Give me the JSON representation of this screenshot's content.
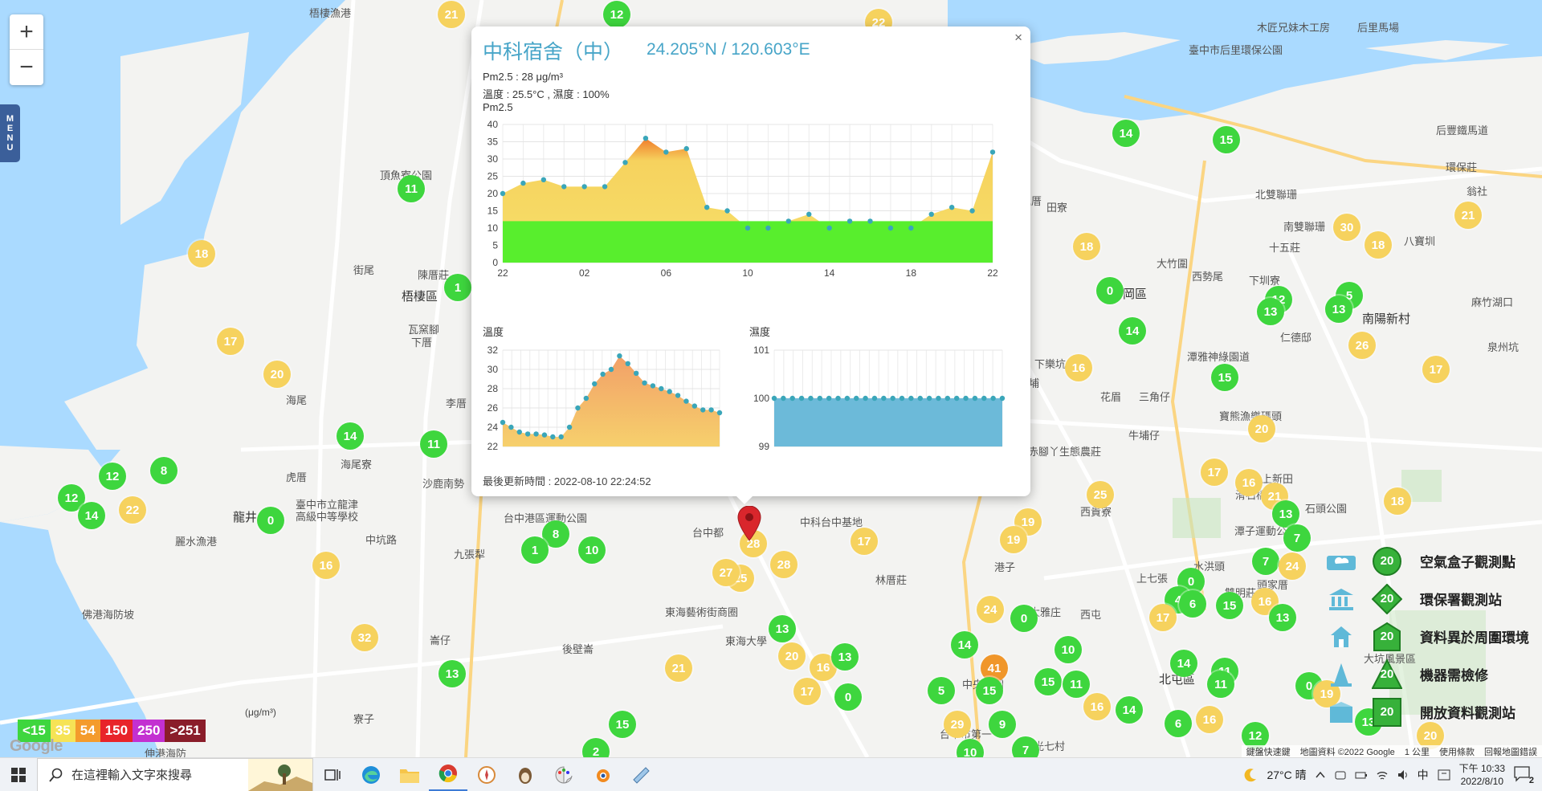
{
  "map": {
    "zoom_in": "+",
    "zoom_out": "−",
    "menu_label": [
      "M",
      "E",
      "N",
      "U"
    ],
    "places": [
      {
        "t": "梧棲漁港",
        "x": 385,
        "y": 6
      },
      {
        "t": "頂魚寮公園",
        "x": 473,
        "y": 208
      },
      {
        "t": "梧棲區",
        "x": 500,
        "y": 358,
        "big": true
      },
      {
        "t": "陳厝莊",
        "x": 520,
        "y": 332
      },
      {
        "t": "街尾",
        "x": 440,
        "y": 326
      },
      {
        "t": "瓦窯腳",
        "x": 508,
        "y": 400
      },
      {
        "t": "下厝",
        "x": 512,
        "y": 416
      },
      {
        "t": "海尾",
        "x": 356,
        "y": 488
      },
      {
        "t": "李厝",
        "x": 555,
        "y": 492
      },
      {
        "t": "海尾寮",
        "x": 424,
        "y": 568
      },
      {
        "t": "虎厝",
        "x": 356,
        "y": 584
      },
      {
        "t": "沙鹿南勢",
        "x": 526,
        "y": 592
      },
      {
        "t": "臺中市立龍津",
        "x": 368,
        "y": 618
      },
      {
        "t": "高級中等學校",
        "x": 368,
        "y": 633
      },
      {
        "t": "龍井",
        "x": 290,
        "y": 633,
        "big": true
      },
      {
        "t": "麗水漁港",
        "x": 218,
        "y": 664
      },
      {
        "t": "中坑路",
        "x": 455,
        "y": 662
      },
      {
        "t": "台中港區運動公園",
        "x": 627,
        "y": 635
      },
      {
        "t": "九張犁",
        "x": 565,
        "y": 680
      },
      {
        "t": "佛港海防坡",
        "x": 102,
        "y": 755
      },
      {
        "t": "崙仔",
        "x": 535,
        "y": 787
      },
      {
        "t": "後壁崙",
        "x": 700,
        "y": 798
      },
      {
        "t": "東海藝術街商圈",
        "x": 828,
        "y": 752
      },
      {
        "t": "東海大學",
        "x": 903,
        "y": 788
      },
      {
        "t": "中科台中基地",
        "x": 996,
        "y": 640
      },
      {
        "t": "林厝莊",
        "x": 1090,
        "y": 712
      },
      {
        "t": "台中都",
        "x": 862,
        "y": 653
      },
      {
        "t": "中塊厝",
        "x": 1258,
        "y": 240
      },
      {
        "t": "田寮",
        "x": 1303,
        "y": 248
      },
      {
        "t": "大竹圍",
        "x": 1440,
        "y": 318
      },
      {
        "t": "神岡區",
        "x": 1383,
        "y": 355,
        "big": true
      },
      {
        "t": "西勢尾",
        "x": 1484,
        "y": 334
      },
      {
        "t": "下圳寮",
        "x": 1555,
        "y": 339
      },
      {
        "t": "北雙聯珊",
        "x": 1563,
        "y": 232
      },
      {
        "t": "南雙聯珊",
        "x": 1598,
        "y": 272
      },
      {
        "t": "十五莊",
        "x": 1580,
        "y": 298
      },
      {
        "t": "南陽新村",
        "x": 1696,
        "y": 386,
        "big": true
      },
      {
        "t": "仁德邸",
        "x": 1594,
        "y": 410
      },
      {
        "t": "潭雅神綠園道",
        "x": 1478,
        "y": 434
      },
      {
        "t": "花眉",
        "x": 1370,
        "y": 484
      },
      {
        "t": "三角仔",
        "x": 1418,
        "y": 484
      },
      {
        "t": "牛埔仔",
        "x": 1405,
        "y": 532
      },
      {
        "t": "赤腳丫生態農莊",
        "x": 1280,
        "y": 552
      },
      {
        "t": "西貴寮",
        "x": 1345,
        "y": 627
      },
      {
        "t": "上七張",
        "x": 1415,
        "y": 710
      },
      {
        "t": "水洪頭",
        "x": 1486,
        "y": 695
      },
      {
        "t": "頭家厝",
        "x": 1565,
        "y": 718
      },
      {
        "t": "潭子運動公園",
        "x": 1537,
        "y": 651
      },
      {
        "t": "上新田",
        "x": 1571,
        "y": 586
      },
      {
        "t": "石頭公園",
        "x": 1625,
        "y": 623
      },
      {
        "t": "北屯區",
        "x": 1443,
        "y": 835,
        "big": true
      },
      {
        "t": "中央公園",
        "x": 1198,
        "y": 842
      },
      {
        "t": "陸光七村",
        "x": 1274,
        "y": 919
      },
      {
        "t": "港子",
        "x": 1238,
        "y": 696
      },
      {
        "t": "大坑風景區",
        "x": 1698,
        "y": 810
      },
      {
        "t": "臺中市后里環保公園",
        "x": 1480,
        "y": 52
      },
      {
        "t": "后豐鐵馬道",
        "x": 1788,
        "y": 152
      },
      {
        "t": "環保莊",
        "x": 1800,
        "y": 198
      },
      {
        "t": "翁社",
        "x": 1826,
        "y": 228
      },
      {
        "t": "八寶圳",
        "x": 1748,
        "y": 290
      },
      {
        "t": "麻竹湖口",
        "x": 1832,
        "y": 366
      },
      {
        "t": "泉州坑",
        "x": 1852,
        "y": 422
      },
      {
        "t": "木匠兄妹木工房",
        "x": 1565,
        "y": 24
      },
      {
        "t": "后里馬場",
        "x": 1690,
        "y": 24
      },
      {
        "t": "寶熊漁樂碼頭",
        "x": 1518,
        "y": 508
      },
      {
        "t": "下樂坑",
        "x": 1288,
        "y": 443
      },
      {
        "t": "大埔",
        "x": 1268,
        "y": 467
      },
      {
        "t": "滑石橋",
        "x": 1538,
        "y": 606
      },
      {
        "t": "雙明莊",
        "x": 1525,
        "y": 728
      },
      {
        "t": "大雅庄",
        "x": 1282,
        "y": 752
      },
      {
        "t": "西屯",
        "x": 1345,
        "y": 755
      },
      {
        "t": "台中市第一",
        "x": 1170,
        "y": 904
      },
      {
        "t": "寮子",
        "x": 440,
        "y": 885
      },
      {
        "t": "伸港海防",
        "x": 180,
        "y": 928
      }
    ],
    "markers": [
      {
        "v": "21",
        "x": 562,
        "y": 18,
        "c": "y"
      },
      {
        "v": "12",
        "x": 768,
        "y": 18,
        "c": "g"
      },
      {
        "v": "22",
        "x": 1094,
        "y": 28,
        "c": "y"
      },
      {
        "v": "11",
        "x": 512,
        "y": 235,
        "c": "g"
      },
      {
        "v": "18",
        "x": 251,
        "y": 316,
        "c": "y"
      },
      {
        "v": "1",
        "x": 570,
        "y": 358,
        "c": "g"
      },
      {
        "v": "17",
        "x": 287,
        "y": 425,
        "c": "y"
      },
      {
        "v": "20",
        "x": 345,
        "y": 466,
        "c": "y"
      },
      {
        "v": "14",
        "x": 436,
        "y": 543,
        "c": "g"
      },
      {
        "v": "11",
        "x": 540,
        "y": 553,
        "c": "g"
      },
      {
        "v": "12",
        "x": 140,
        "y": 593,
        "c": "g"
      },
      {
        "v": "8",
        "x": 204,
        "y": 586,
        "c": "g"
      },
      {
        "v": "12",
        "x": 89,
        "y": 620,
        "c": "g"
      },
      {
        "v": "14",
        "x": 114,
        "y": 642,
        "c": "g"
      },
      {
        "v": "22",
        "x": 165,
        "y": 635,
        "c": "y"
      },
      {
        "v": "0",
        "x": 337,
        "y": 648,
        "c": "g"
      },
      {
        "v": "8",
        "x": 692,
        "y": 665,
        "c": "g"
      },
      {
        "v": "1",
        "x": 666,
        "y": 685,
        "c": "g"
      },
      {
        "v": "10",
        "x": 737,
        "y": 685,
        "c": "g"
      },
      {
        "v": "16",
        "x": 406,
        "y": 704,
        "c": "y"
      },
      {
        "v": "32",
        "x": 454,
        "y": 794,
        "c": "y"
      },
      {
        "v": "13",
        "x": 563,
        "y": 839,
        "c": "g"
      },
      {
        "v": "15",
        "x": 775,
        "y": 902,
        "c": "g"
      },
      {
        "v": "2",
        "x": 742,
        "y": 936,
        "c": "g"
      },
      {
        "v": "21",
        "x": 845,
        "y": 832,
        "c": "y"
      },
      {
        "v": "28",
        "x": 976,
        "y": 703,
        "c": "y"
      },
      {
        "v": "25",
        "x": 922,
        "y": 720,
        "c": "y"
      },
      {
        "v": "27",
        "x": 904,
        "y": 713,
        "c": "y"
      },
      {
        "v": "28",
        "x": 938,
        "y": 677,
        "c": "y"
      },
      {
        "v": "13",
        "x": 974,
        "y": 783,
        "c": "g"
      },
      {
        "v": "20",
        "x": 986,
        "y": 817,
        "c": "y"
      },
      {
        "v": "16",
        "x": 1025,
        "y": 831,
        "c": "y"
      },
      {
        "v": "13",
        "x": 1052,
        "y": 818,
        "c": "g"
      },
      {
        "v": "17",
        "x": 1005,
        "y": 861,
        "c": "y"
      },
      {
        "v": "0",
        "x": 1056,
        "y": 868,
        "c": "g"
      },
      {
        "v": "17",
        "x": 1076,
        "y": 674,
        "c": "y"
      },
      {
        "v": "19",
        "x": 1280,
        "y": 650,
        "c": "y"
      },
      {
        "v": "19",
        "x": 1262,
        "y": 672,
        "c": "y"
      },
      {
        "v": "25",
        "x": 1370,
        "y": 616,
        "c": "y"
      },
      {
        "v": "24",
        "x": 1233,
        "y": 759,
        "c": "y"
      },
      {
        "v": "0",
        "x": 1275,
        "y": 770,
        "c": "g"
      },
      {
        "v": "14",
        "x": 1201,
        "y": 803,
        "c": "g"
      },
      {
        "v": "10",
        "x": 1330,
        "y": 809,
        "c": "g"
      },
      {
        "v": "41",
        "x": 1238,
        "y": 832,
        "c": "o"
      },
      {
        "v": "5",
        "x": 1172,
        "y": 860,
        "c": "g"
      },
      {
        "v": "15",
        "x": 1232,
        "y": 860,
        "c": "g"
      },
      {
        "v": "15",
        "x": 1305,
        "y": 849,
        "c": "g"
      },
      {
        "v": "11",
        "x": 1340,
        "y": 852,
        "c": "g"
      },
      {
        "v": "29",
        "x": 1192,
        "y": 902,
        "c": "y"
      },
      {
        "v": "9",
        "x": 1248,
        "y": 902,
        "c": "g"
      },
      {
        "v": "16",
        "x": 1366,
        "y": 880,
        "c": "y"
      },
      {
        "v": "14",
        "x": 1406,
        "y": 884,
        "c": "g"
      },
      {
        "v": "10",
        "x": 1208,
        "y": 937,
        "c": "g"
      },
      {
        "v": "7",
        "x": 1277,
        "y": 934,
        "c": "g"
      },
      {
        "v": "14",
        "x": 1402,
        "y": 166,
        "c": "g"
      },
      {
        "v": "15",
        "x": 1527,
        "y": 174,
        "c": "g"
      },
      {
        "v": "18",
        "x": 1353,
        "y": 307,
        "c": "y"
      },
      {
        "v": "0",
        "x": 1382,
        "y": 362,
        "c": "g"
      },
      {
        "v": "14",
        "x": 1410,
        "y": 412,
        "c": "g"
      },
      {
        "v": "16",
        "x": 1343,
        "y": 458,
        "c": "y"
      },
      {
        "v": "15",
        "x": 1525,
        "y": 470,
        "c": "g"
      },
      {
        "v": "20",
        "x": 1571,
        "y": 534,
        "c": "y"
      },
      {
        "v": "17",
        "x": 1512,
        "y": 588,
        "c": "y"
      },
      {
        "v": "30",
        "x": 1677,
        "y": 283,
        "c": "y"
      },
      {
        "v": "18",
        "x": 1716,
        "y": 305,
        "c": "y"
      },
      {
        "v": "21",
        "x": 1828,
        "y": 268,
        "c": "y"
      },
      {
        "v": "12",
        "x": 1592,
        "y": 373,
        "c": "g"
      },
      {
        "v": "13",
        "x": 1582,
        "y": 388,
        "c": "g"
      },
      {
        "v": "5",
        "x": 1680,
        "y": 368,
        "c": "g"
      },
      {
        "v": "13",
        "x": 1667,
        "y": 385,
        "c": "g"
      },
      {
        "v": "26",
        "x": 1696,
        "y": 430,
        "c": "y"
      },
      {
        "v": "17",
        "x": 1788,
        "y": 460,
        "c": "y"
      },
      {
        "v": "16",
        "x": 1555,
        "y": 601,
        "c": "y"
      },
      {
        "v": "21",
        "x": 1587,
        "y": 618,
        "c": "y"
      },
      {
        "v": "13",
        "x": 1601,
        "y": 640,
        "c": "g"
      },
      {
        "v": "7",
        "x": 1615,
        "y": 670,
        "c": "g"
      },
      {
        "v": "18",
        "x": 1740,
        "y": 624,
        "c": "y"
      },
      {
        "v": "7",
        "x": 1576,
        "y": 699,
        "c": "g"
      },
      {
        "v": "24",
        "x": 1609,
        "y": 705,
        "c": "y"
      },
      {
        "v": "0",
        "x": 1483,
        "y": 724,
        "c": "g"
      },
      {
        "v": "4",
        "x": 1467,
        "y": 747,
        "c": "g"
      },
      {
        "v": "6",
        "x": 1485,
        "y": 752,
        "c": "g"
      },
      {
        "v": "15",
        "x": 1531,
        "y": 754,
        "c": "g"
      },
      {
        "v": "16",
        "x": 1575,
        "y": 749,
        "c": "y"
      },
      {
        "v": "13",
        "x": 1597,
        "y": 769,
        "c": "g"
      },
      {
        "v": "17",
        "x": 1448,
        "y": 769,
        "c": "y"
      },
      {
        "v": "14",
        "x": 1474,
        "y": 826,
        "c": "g"
      },
      {
        "v": "11",
        "x": 1525,
        "y": 836,
        "c": "g"
      },
      {
        "v": "11",
        "x": 1520,
        "y": 852,
        "c": "g"
      },
      {
        "v": "6",
        "x": 1467,
        "y": 901,
        "c": "g"
      },
      {
        "v": "16",
        "x": 1506,
        "y": 896,
        "c": "y"
      },
      {
        "v": "12",
        "x": 1563,
        "y": 916,
        "c": "g"
      },
      {
        "v": "0",
        "x": 1630,
        "y": 854,
        "c": "g"
      },
      {
        "v": "19",
        "x": 1652,
        "y": 864,
        "c": "y"
      },
      {
        "v": "20",
        "x": 1781,
        "y": 916,
        "c": "y"
      },
      {
        "v": "13",
        "x": 1704,
        "y": 899,
        "c": "g"
      }
    ],
    "aqi_legend": [
      {
        "label": "<15",
        "color": "#3ed63e"
      },
      {
        "label": "35",
        "color": "#f6e356"
      },
      {
        "label": "54",
        "color": "#f49b2c"
      },
      {
        "label": "150",
        "color": "#e8242a"
      },
      {
        "label": "250",
        "color": "#c330d1"
      },
      {
        "label": ">251",
        "color": "#8a1d2a"
      }
    ],
    "unit_label": "(μg/m³)",
    "google_logo": "Google",
    "type_legend": [
      {
        "label": "空氣盒子觀測點",
        "value": "20",
        "icon": "cloud-box-icon",
        "symbol": "circle"
      },
      {
        "label": "環保署觀測站",
        "value": "20",
        "icon": "government-building-icon",
        "symbol": "diamond"
      },
      {
        "label": "資料異於周圍環境",
        "value": "20",
        "icon": "house-icon",
        "symbol": "house"
      },
      {
        "label": "機器需檢修",
        "value": "20",
        "icon": "cone-icon",
        "symbol": "triangle"
      },
      {
        "label": "開放資料觀測站",
        "value": "20",
        "icon": "box-icon",
        "symbol": "square"
      }
    ],
    "attribution": {
      "shortcuts": "鍵盤快速鍵",
      "data": "地圖資料 ©2022 Google",
      "scale": "1 公里",
      "terms": "使用條款",
      "report": "回報地圖錯誤"
    }
  },
  "popup": {
    "close": "×",
    "title": "中科宿舍（中）",
    "coords": "24.205°N / 120.603°E",
    "pm25_line": "Pm2.5 : 28 μg/m³",
    "temp_line": "溫度 : 25.5°C , 濕度 : 100%",
    "pm25_chart_label": "Pm2.5",
    "temp_chart_label": "溫度",
    "humidity_chart_label": "濕度",
    "updated": "最後更新時間 : 2022-08-10 22:24:52"
  },
  "chart_data": [
    {
      "type": "area",
      "title": "Pm2.5",
      "xlabel": "",
      "ylabel": "",
      "x_ticks": [
        "22",
        "02",
        "06",
        "10",
        "14",
        "18",
        "22"
      ],
      "ylim": [
        0,
        40
      ],
      "y_ticks": [
        0,
        5,
        10,
        15,
        20,
        25,
        30,
        35,
        40
      ],
      "grid": true,
      "values": [
        20,
        23,
        24,
        22,
        22,
        22,
        29,
        36,
        32,
        33,
        16,
        15,
        10,
        10,
        12,
        14,
        10,
        12,
        12,
        10,
        10,
        14,
        16,
        15,
        32
      ]
    },
    {
      "type": "area",
      "title": "溫度",
      "ylim": [
        22,
        32
      ],
      "y_ticks": [
        22,
        24,
        26,
        28,
        30,
        32
      ],
      "grid": true,
      "values": [
        24.5,
        24,
        23.5,
        23.3,
        23.3,
        23.2,
        23.0,
        23.0,
        24.0,
        26.0,
        27.0,
        28.5,
        29.5,
        30.0,
        31.4,
        30.6,
        29.6,
        28.6,
        28.3,
        28.0,
        27.7,
        27.3,
        26.7,
        26.2,
        25.8,
        25.8,
        25.5
      ]
    },
    {
      "type": "area",
      "title": "濕度",
      "ylim": [
        99,
        101
      ],
      "y_ticks": [
        99,
        100,
        101
      ],
      "grid": true,
      "values": [
        100,
        100,
        100,
        100,
        100,
        100,
        100,
        100,
        100,
        100,
        100,
        100,
        100,
        100,
        100,
        100,
        100,
        100,
        100,
        100,
        100,
        100,
        100,
        100,
        100,
        100
      ]
    }
  ],
  "taskbar": {
    "search_placeholder": "在這裡輸入文字來搜尋",
    "weather": "27°C 晴",
    "ime": "中",
    "time": "下午 10:33",
    "date": "2022/8/10",
    "notifications": "2"
  }
}
